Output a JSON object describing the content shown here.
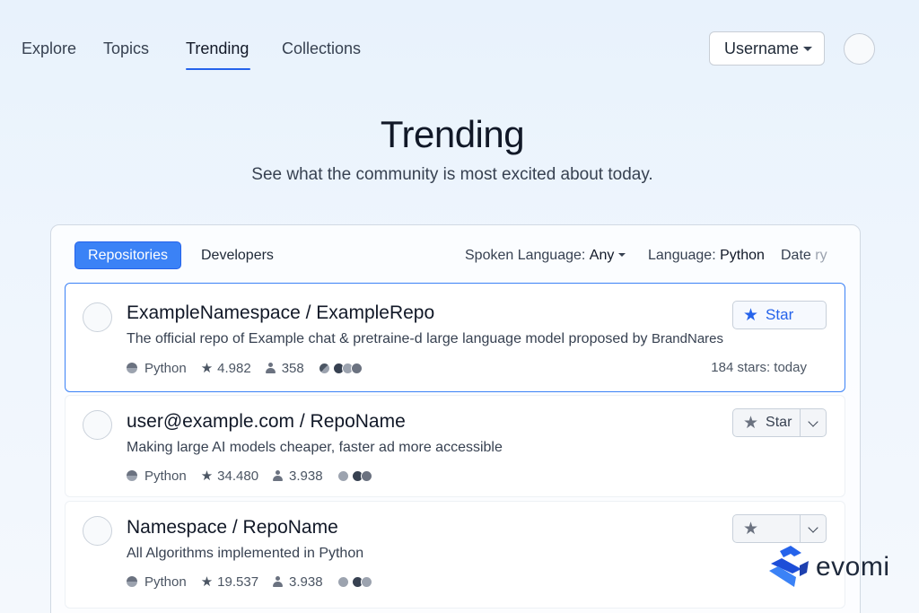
{
  "nav": {
    "items": [
      "Explore",
      "Topics",
      "Trending",
      "Collections"
    ],
    "active": "Trending",
    "user_dropdown": "Username"
  },
  "hero": {
    "title": "Trending",
    "subtitle": "See what the community is most excited about today."
  },
  "tabs": {
    "repositories": "Repositories",
    "developers": "Developers"
  },
  "filters": {
    "spoken_language_label": "Spoken Language:",
    "spoken_language_value": "Any",
    "language_label": "Language:",
    "language_value": "Python",
    "date_label": "Date",
    "date_value_partial": "ry"
  },
  "repos": [
    {
      "name": "ExampleNamespace / ExampleRepo",
      "description": "The official repo of Example chat & pretraine-d large language model proposed by",
      "description_by": "BrandNares",
      "language": "Python",
      "stars": "4.982",
      "forks": "358",
      "stars_today": "184 stars: today",
      "star_button": "Star",
      "selected": true
    },
    {
      "name": "user@example.com / RepoName",
      "description": "Making large AI models cheaper, faster ad more accessible",
      "language": "Python",
      "stars": "34.480",
      "forks": "3.938",
      "star_button": "Star"
    },
    {
      "name": "Namespace / RepoName",
      "description": "All Algorithms implemented in Python",
      "language": "Python",
      "stars": "19.537",
      "forks": "3.938",
      "star_button": ""
    }
  ],
  "icons": {
    "star": "star-icon",
    "language": "language-dot-icon",
    "forks": "person-icon"
  },
  "colors": {
    "accent": "#3b82f6",
    "accent_dark": "#2563eb",
    "background": "#e8f2fc"
  },
  "watermark": {
    "text": "evomi"
  }
}
